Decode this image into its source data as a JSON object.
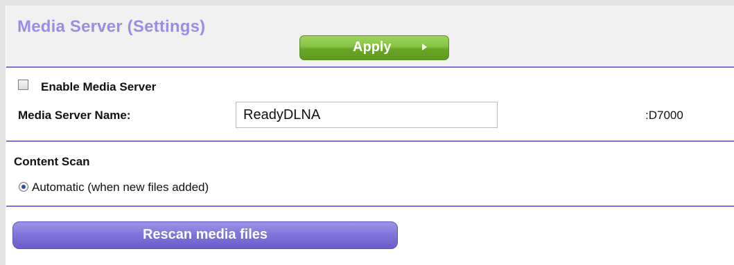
{
  "header": {
    "title": "Media Server (Settings)",
    "apply_label": "Apply"
  },
  "media_server": {
    "enable_label": "Enable Media Server",
    "enable_checked": false,
    "name_label": "Media Server Name:",
    "name_value": "ReadyDLNA",
    "name_suffix": ":D7000"
  },
  "content_scan": {
    "heading": "Content Scan",
    "option_label": "Automatic (when new files added)",
    "option_selected": true
  },
  "actions": {
    "rescan_label": "Rescan media files"
  },
  "colors": {
    "title": "#9b8ce6",
    "divider": "#7b6fd6",
    "apply_button": "#86c340",
    "rescan_button": "#7f72d8"
  }
}
